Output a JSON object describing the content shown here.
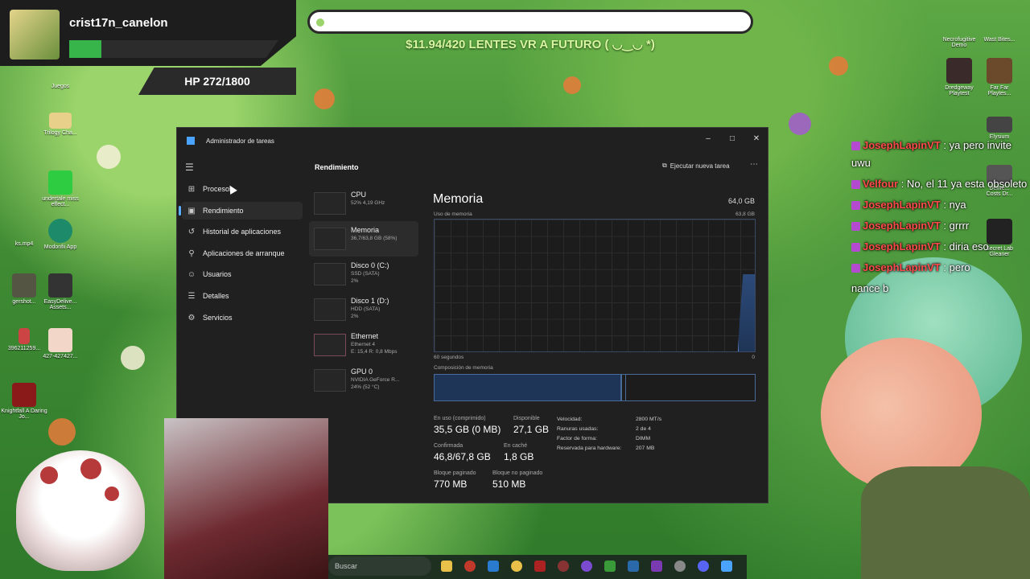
{
  "overlay": {
    "username": "crist17n_canelon",
    "hp": "HP 272/1800",
    "goal_text": "$11.94/420 LENTES VR A FUTURO ( ◡‿◡ *)"
  },
  "desktop_left": [
    {
      "label": "Juegos"
    },
    {
      "label": "Trilogy Cha..."
    },
    {
      "label": "undertale miss effect..."
    },
    {
      "label": "Modonfii App"
    },
    {
      "label": "ks.mp4"
    },
    {
      "label": "gershot..."
    },
    {
      "label": "EasyDelive... Assets..."
    },
    {
      "label": "396211259..."
    },
    {
      "label": "427-427427..."
    },
    {
      "label": "Knightfall A Daring Jo..."
    }
  ],
  "desktop_right": [
    {
      "label": "Necrofugitive Demo"
    },
    {
      "label": "Wast Bites..."
    },
    {
      "label": "Dredgeway Playtest"
    },
    {
      "label": "Far Far Playtes..."
    },
    {
      "label": "Elysium"
    },
    {
      "label": "Delive... Costs Dr..."
    },
    {
      "label": "Secret Lab Gleaner"
    }
  ],
  "task_manager": {
    "window_title": "Administrador de tareas",
    "window_buttons": {
      "minimize": "–",
      "maximize": "□",
      "close": "✕"
    },
    "nav": [
      {
        "label": "Procesos",
        "icon": "processes-icon"
      },
      {
        "label": "Rendimiento",
        "icon": "performance-icon",
        "active": true
      },
      {
        "label": "Historial de aplicaciones",
        "icon": "history-icon"
      },
      {
        "label": "Aplicaciones de arranque",
        "icon": "startup-icon"
      },
      {
        "label": "Usuarios",
        "icon": "users-icon"
      },
      {
        "label": "Detalles",
        "icon": "details-icon"
      },
      {
        "label": "Servicios",
        "icon": "services-icon"
      }
    ],
    "page_title": "Rendimiento",
    "run_task": "Ejecutar nueva tarea",
    "devices": [
      {
        "name": "CPU",
        "sub1": "52% 4,19 GHz",
        "sub2": ""
      },
      {
        "name": "Memoria",
        "sub1": "36,7/63,8 GB (58%)",
        "sub2": ""
      },
      {
        "name": "Disco 0 (C:)",
        "sub1": "SSD (SATA)",
        "sub2": "2%"
      },
      {
        "name": "Disco 1 (D:)",
        "sub1": "HDD (SATA)",
        "sub2": "2%"
      },
      {
        "name": "Ethernet",
        "sub1": "Ethernet 4",
        "sub2": "E: 15,4 R: 0,8 Mbps"
      },
      {
        "name": "GPU 0",
        "sub1": "NVIDIA GeForce R...",
        "sub2": "24% (52 °C)"
      }
    ],
    "memory": {
      "title": "Memoria",
      "total": "64,0 GB",
      "usage_label": "Uso de memoria",
      "usage_max": "63,8 GB",
      "graph_left": "60 segundos",
      "graph_right": "0",
      "composition_label": "Composición de memoria",
      "composition_used_fraction": 0.58,
      "stats": {
        "in_use_label": "En uso (comprimido)",
        "in_use_value": "35,5 GB (0 MB)",
        "available_label": "Disponible",
        "available_value": "27,1 GB",
        "committed_label": "Confirmada",
        "committed_value": "46,8/67,8 GB",
        "cached_label": "En caché",
        "cached_value": "1,8 GB",
        "paged_label": "Bloque paginado",
        "paged_value": "770 MB",
        "nonpaged_label": "Bloque no paginado",
        "nonpaged_value": "510 MB"
      },
      "specs": [
        {
          "label": "Velocidad:",
          "value": "2800 MT/s"
        },
        {
          "label": "Ranuras usadas:",
          "value": "2 de 4"
        },
        {
          "label": "Factor de forma:",
          "value": "DIMM"
        },
        {
          "label": "Reservada para hardware:",
          "value": "207 MB"
        }
      ]
    }
  },
  "taskbar": {
    "search_placeholder": "Buscar"
  },
  "chat": [
    {
      "user": "JosephLapinVT",
      "msg": ": ya pero invite uwu"
    },
    {
      "user": "Velfour",
      "msg": ": No, el 11 ya esta obsoleto"
    },
    {
      "user": "JosephLapinVT",
      "msg": ": nya"
    },
    {
      "user": "JosephLapinVT",
      "msg": ": grrrr"
    },
    {
      "user": "JosephLapinVT",
      "msg": ": diria eso"
    },
    {
      "user": "JosephLapinVT",
      "msg": ": pero"
    },
    {
      "user": "",
      "msg": "nance b"
    }
  ],
  "colors": {
    "accent": "#5ab0ff",
    "memory_fill": "#1f3557",
    "chat_user": "#ff4a4a"
  }
}
